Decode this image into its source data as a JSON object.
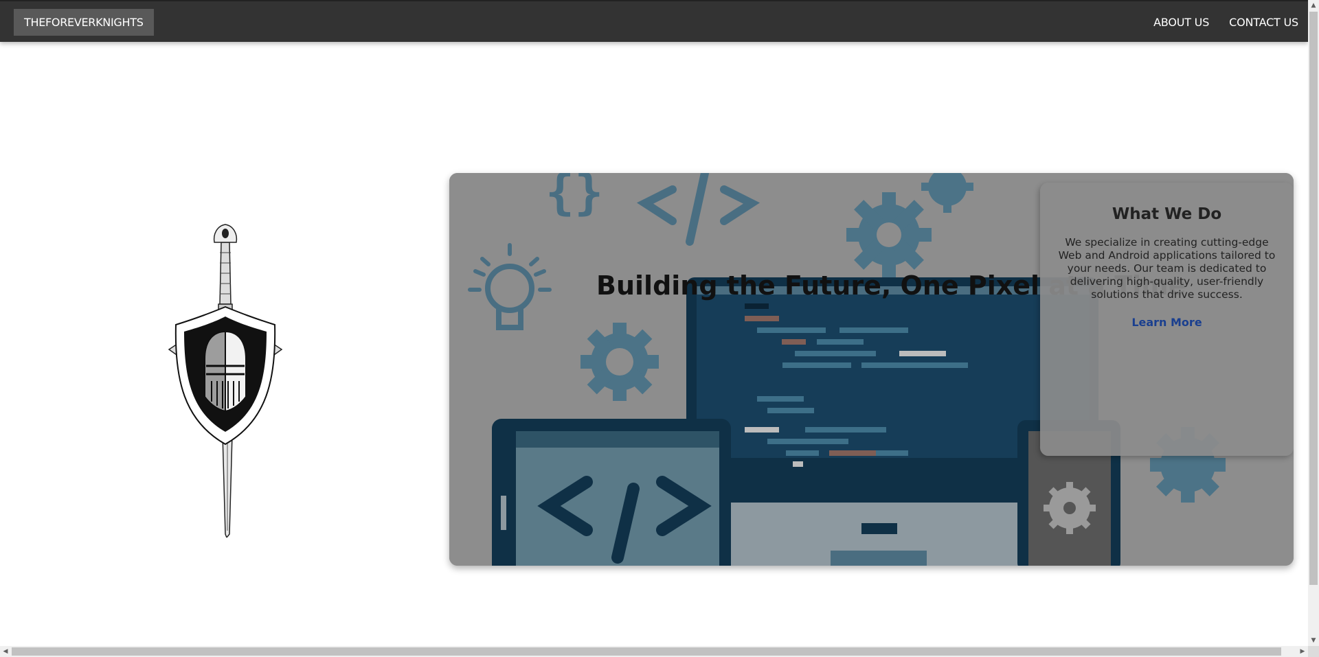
{
  "navbar": {
    "brand": "THEFOREVERKNIGHTS",
    "links": [
      "ABOUT US",
      "CONTACT US"
    ]
  },
  "hero": {
    "title": "Building the Future, One Pixel at a Time",
    "card": {
      "title": "What We Do",
      "text": "We specialize in creating cutting-edge Web and Android applications tailored to your needs. Our team is dedicated to delivering high-quality, user-friendly solutions that drive success.",
      "link": "Learn More"
    }
  },
  "icons": {
    "logo": "knight-shield-sword-logo",
    "hero_art": "coding-devices-illustration"
  },
  "colors": {
    "navbar": "#333333",
    "brand_bg": "#595959",
    "link": "#1a3f8f"
  }
}
